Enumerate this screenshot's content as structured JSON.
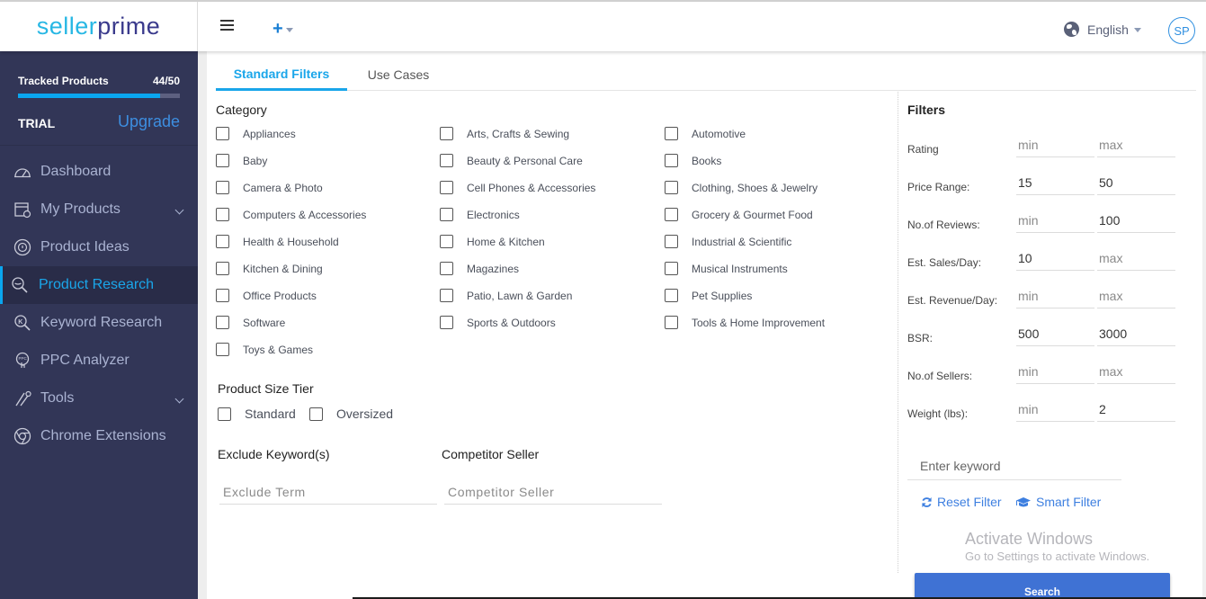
{
  "header": {
    "logo_part1": "seller",
    "logo_part2": "prime",
    "menu_icon": "hamburger-icon",
    "add_icon": "plus-icon",
    "language": "English",
    "avatar_initials": "SP"
  },
  "sidebar": {
    "tracked_label": "Tracked Products",
    "tracked_count": "44/50",
    "tracked_progress": 0.88,
    "plan": "TRIAL",
    "upgrade_label": "Upgrade",
    "items": [
      {
        "label": "Dashboard",
        "icon": "speedometer-icon",
        "expandable": false,
        "active": false
      },
      {
        "label": "My Products",
        "icon": "box-icon",
        "expandable": true,
        "active": false
      },
      {
        "label": "Product Ideas",
        "icon": "lightbulb-icon",
        "expandable": false,
        "active": false
      },
      {
        "label": "Product Research",
        "icon": "search-icon",
        "expandable": false,
        "active": true
      },
      {
        "label": "Keyword Research",
        "icon": "keyword-search-icon",
        "expandable": false,
        "active": false
      },
      {
        "label": "PPC Analyzer",
        "icon": "ppc-icon",
        "expandable": false,
        "active": false
      },
      {
        "label": "Tools",
        "icon": "tools-icon",
        "expandable": true,
        "active": false
      },
      {
        "label": "Chrome Extensions",
        "icon": "chrome-icon",
        "expandable": false,
        "active": false
      }
    ]
  },
  "tabs": [
    {
      "label": "Standard Filters",
      "active": true
    },
    {
      "label": "Use Cases",
      "active": false
    }
  ],
  "category": {
    "title": "Category",
    "items": [
      "Appliances",
      "Arts, Crafts & Sewing",
      "Automotive",
      "Baby",
      "Beauty & Personal Care",
      "Books",
      "Camera & Photo",
      "Cell Phones & Accessories",
      "Clothing, Shoes & Jewelry",
      "Computers & Accessories",
      "Electronics",
      "Grocery & Gourmet Food",
      "Health & Household",
      "Home & Kitchen",
      "Industrial & Scientific",
      "Kitchen & Dining",
      "Magazines",
      "Musical Instruments",
      "Office Products",
      "Patio, Lawn & Garden",
      "Pet Supplies",
      "Software",
      "Sports & Outdoors",
      "Tools & Home Improvement",
      "Toys & Games"
    ]
  },
  "size_tier": {
    "title": "Product Size Tier",
    "options": [
      "Standard",
      "Oversized"
    ]
  },
  "exclude": {
    "title": "Exclude Keyword(s)",
    "placeholder": "Exclude Term",
    "value": ""
  },
  "competitor": {
    "title": "Competitor Seller",
    "placeholder": "Competitor Seller",
    "value": ""
  },
  "filters": {
    "title": "Filters",
    "min_placeholder": "min",
    "max_placeholder": "max",
    "rows": [
      {
        "label": "Rating",
        "min": "",
        "max": ""
      },
      {
        "label": "Price Range:",
        "min": "15",
        "max": "50"
      },
      {
        "label": "No.of Reviews:",
        "min": "",
        "max": "100"
      },
      {
        "label": "Est. Sales/Day:",
        "min": "10",
        "max": ""
      },
      {
        "label": "Est. Revenue/Day:",
        "min": "",
        "max": ""
      },
      {
        "label": "BSR:",
        "min": "500",
        "max": "3000"
      },
      {
        "label": "No.of Sellers:",
        "min": "",
        "max": ""
      },
      {
        "label": "Weight (lbs):",
        "min": "",
        "max": "2"
      }
    ],
    "keyword_placeholder": "Enter keyword",
    "reset_label": "Reset Filter",
    "smart_label": "Smart Filter",
    "search_label": "Search"
  },
  "watermark": {
    "line1": "Activate Windows",
    "line2": "Go to Settings to activate Windows."
  },
  "colors": {
    "accent": "#1aa6ea",
    "sidebar_bg": "#323657",
    "button": "#3f72d4",
    "link": "#3d7fe0"
  }
}
